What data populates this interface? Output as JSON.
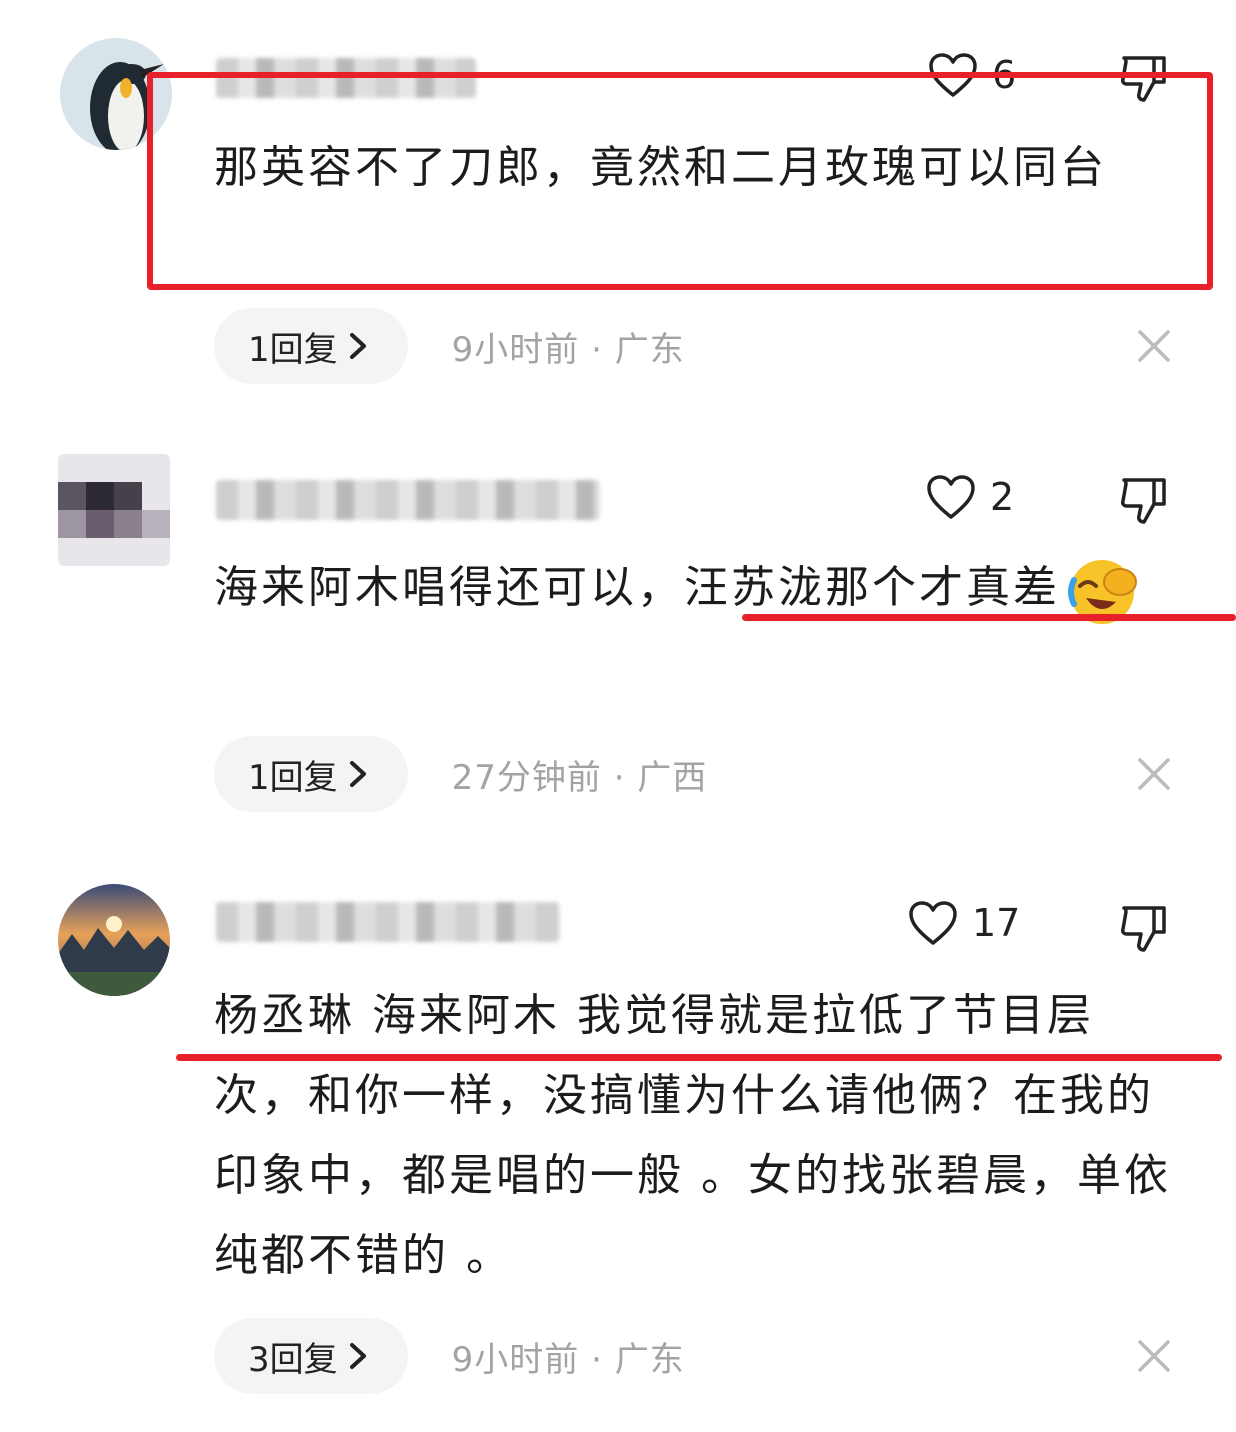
{
  "comments": [
    {
      "likes": "6",
      "text": "那英容不了刀郎，竟然和二月玫瑰可以同台",
      "reply_label": "1回复",
      "time_location": "9小时前 · 广东"
    },
    {
      "likes": "2",
      "text": "海来阿木唱得还可以，汪苏泷那个才真差",
      "reply_label": "1回复",
      "time_location": "27分钟前 · 广西"
    },
    {
      "likes": "17",
      "text": "杨丞琳 海来阿木 我觉得就是拉低了节目层次，和你一样，没搞懂为什么请他俩？在我的印象中，都是唱的一般 。女的找张碧晨，单依纯都不错的 。",
      "reply_label": "3回复",
      "time_location": "9小时前 · 广东"
    }
  ],
  "colors": {
    "annotation_red": "#e8202a",
    "meta_gray": "#a3a3a3",
    "pill_bg": "#f4f4f4"
  },
  "icons": [
    "heart-icon",
    "thumbs-down-icon",
    "chevron-right-icon",
    "close-icon",
    "laughing-emoji"
  ]
}
